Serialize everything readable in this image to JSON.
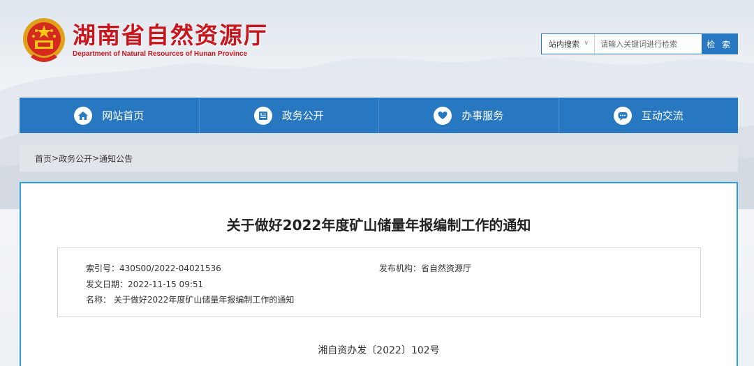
{
  "header": {
    "title": "湖南省自然资源厅",
    "subtitle": "Department of Natural Resources of Hunan Province"
  },
  "search": {
    "scope_label": "站内搜索",
    "placeholder": "请输入关键词进行检索",
    "button_label": "检 索"
  },
  "nav": {
    "items": [
      {
        "label": "网站首页",
        "icon": "home-icon"
      },
      {
        "label": "政务公开",
        "icon": "document-list-icon"
      },
      {
        "label": "办事服务",
        "icon": "heart-hands-icon"
      },
      {
        "label": "互动交流",
        "icon": "chat-bubble-icon"
      }
    ]
  },
  "breadcrumb": {
    "items": [
      "首页",
      "政务公开",
      "通知公告"
    ],
    "separator": ">"
  },
  "article": {
    "title": "关于做好2022年度矿山储量年报编制工作的通知",
    "meta": {
      "index_no": "索引号：430S00/2022-04021536",
      "publisher": "发布机构：省自然资源厅",
      "date": "发文日期：2022-11-15 09:51",
      "name": "名称： 关于做好2022年度矿山储量年报编制工作的通知"
    },
    "doc_number": "湘自资办发〔2022〕102号"
  },
  "colors": {
    "brand_red": "#c8161d",
    "nav_blue": "#2777c1",
    "content_border": "#2aa0d8"
  }
}
